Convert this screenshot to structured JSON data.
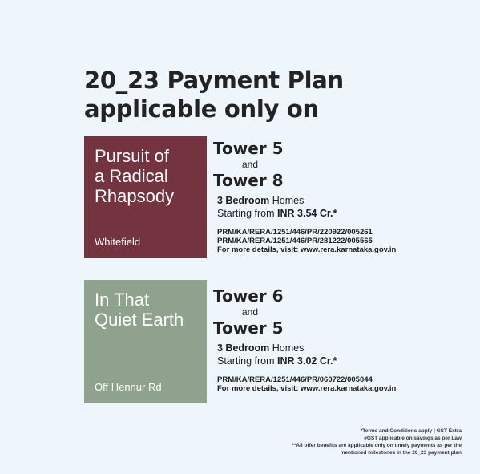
{
  "headline": {
    "line1": "20_23 Payment Plan",
    "line2": "applicable only on"
  },
  "projects": [
    {
      "name_lines": [
        "Pursuit of",
        "a Radical",
        "Rhapsody"
      ],
      "location": "Whitefield",
      "color": "#74343f",
      "tower_a": "Tower 5",
      "conj": "and",
      "tower_b": "Tower 8",
      "bedroom_bold": "3 Bedroom",
      "bedroom_rest": " Homes",
      "price_prefix": "Starting from ",
      "price": "INR 3.54 Cr.*",
      "rera": [
        "PRM/KA/RERA/1251/446/PR/220922/005261",
        "PRM/KA/RERA/1251/446/PR/281222/005565"
      ],
      "more": "For more details, visit: www.rera.karnataka.gov.in"
    },
    {
      "name_lines": [
        "In That",
        "Quiet Earth"
      ],
      "location": "Off Hennur Rd",
      "color": "#8fa28d",
      "tower_a": "Tower 6",
      "conj": "and",
      "tower_b": "Tower 5",
      "bedroom_bold": "3 Bedroom",
      "bedroom_rest": " Homes",
      "price_prefix": "Starting from ",
      "price": "INR 3.02 Cr.*",
      "rera": [
        "PRM/KA/RERA/1251/446/PR/060722/005044"
      ],
      "more": "For more details, visit: www.rera.karnataka.gov.in"
    }
  ],
  "footnotes": [
    "*Terms and Conditions apply  |  GST Extra",
    "#GST applicable on savings as per Law",
    "**All offer benefits are applicable only on timely payments as per the",
    "mentioned milestones in the 20_23 payment plan"
  ]
}
